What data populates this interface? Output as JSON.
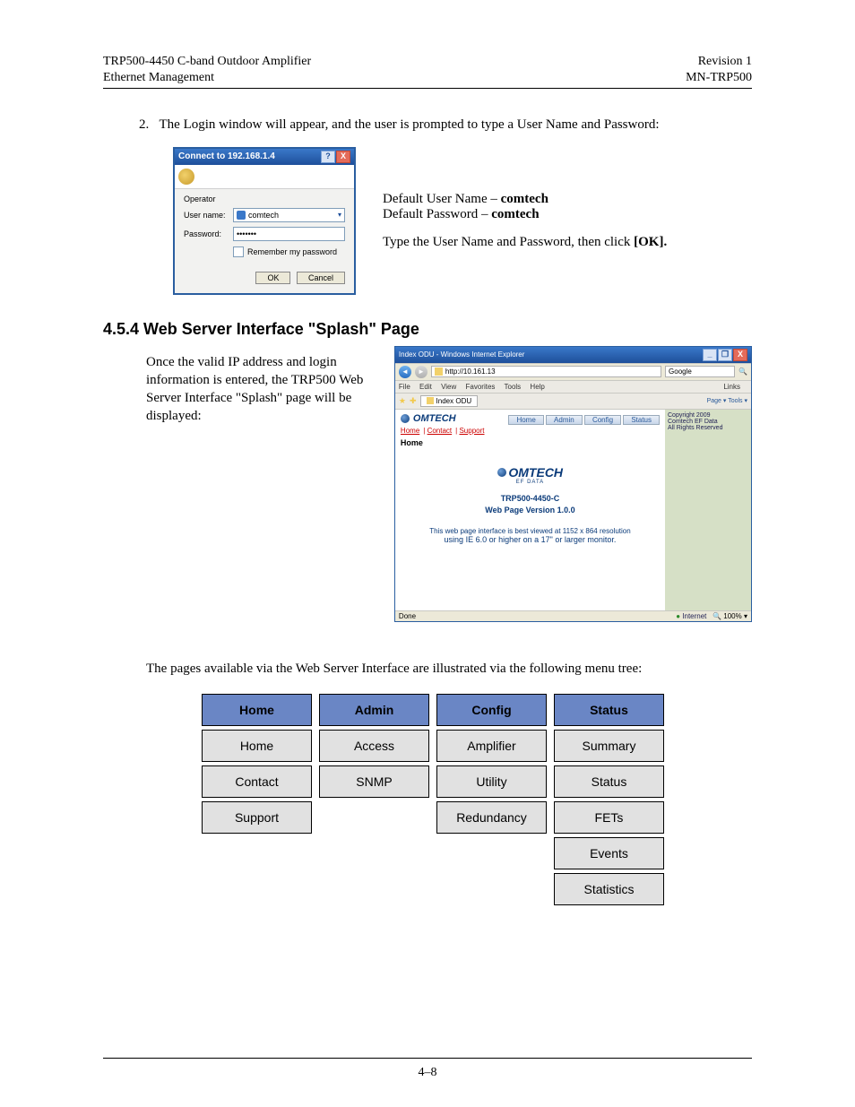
{
  "header": {
    "left_line1": "TRP500-4450 C-band Outdoor Amplifier",
    "left_line2": "Ethernet Management",
    "right_line1": "Revision 1",
    "right_line2": "MN-TRP500"
  },
  "step2_num": "2.",
  "step2_text": "The Login window will appear, and the user is prompted to type a User Name and Password:",
  "login_dialog": {
    "title": "Connect to 192.168.1.4",
    "help": "?",
    "close": "X",
    "server": "Operator",
    "user_label": "User name:",
    "user_value": "comtech",
    "pw_label": "Password:",
    "pw_value": "•••••••",
    "remember": "Remember my password",
    "ok": "OK",
    "cancel": "Cancel"
  },
  "defaults": {
    "line1a": "Default User Name – ",
    "line1b": "comtech",
    "line2a": "Default Password – ",
    "line2b": "comtech",
    "line3a": "Type the User Name and Password, then click ",
    "line3b": "[OK]."
  },
  "heading_454": "4.5.4  Web Server Interface \"Splash\" Page",
  "intro_454": "Once the valid IP address and login information is entered, the TRP500 Web Server Interface \"Splash\" page will be displayed:",
  "browser": {
    "title": "Index ODU - Windows Internet Explorer",
    "min": "_",
    "max": "❐",
    "close": "X",
    "url": "http://10.161.13",
    "search_engine": "Google",
    "menu": {
      "file": "File",
      "edit": "Edit",
      "view": "View",
      "favorites": "Favorites",
      "tools": "Tools",
      "help": "Help"
    },
    "links_label": "Links",
    "tab": "Index ODU",
    "toolbar": "Page ▾  Tools ▾",
    "logo_text": "OMTECH",
    "logo_sub": "EF DATA",
    "nav_tabs": [
      "Home",
      "Admin",
      "Config",
      "Status"
    ],
    "crumb_links": [
      "Home",
      "Contact",
      "Support"
    ],
    "page_label": "Home",
    "splash_model": "TRP500-4450-C",
    "splash_version": "Web Page Version 1.0.0",
    "splash_note1": "This web page interface is best viewed at 1152 x 864 resolution",
    "splash_note2": "using IE 6.0 or higher on a 17\" or larger monitor.",
    "side_copyright": "Copyright 2009",
    "side_company": "Comtech EF Data",
    "side_rights": "All Rights Reserved",
    "status_done": "Done",
    "status_zone": "Internet",
    "status_zoom": "100%"
  },
  "tree_intro": "The pages available via the Web Server Interface are illustrated via the following menu tree:",
  "menu_tree": {
    "home": {
      "header": "Home",
      "items": [
        "Home",
        "Contact",
        "Support"
      ]
    },
    "admin": {
      "header": "Admin",
      "items": [
        "Access",
        "SNMP"
      ]
    },
    "config": {
      "header": "Config",
      "items": [
        "Amplifier",
        "Utility",
        "Redundancy"
      ]
    },
    "status": {
      "header": "Status",
      "items": [
        "Summary",
        "Status",
        "FETs",
        "Events",
        "Statistics"
      ]
    }
  },
  "page_number": "4–8"
}
